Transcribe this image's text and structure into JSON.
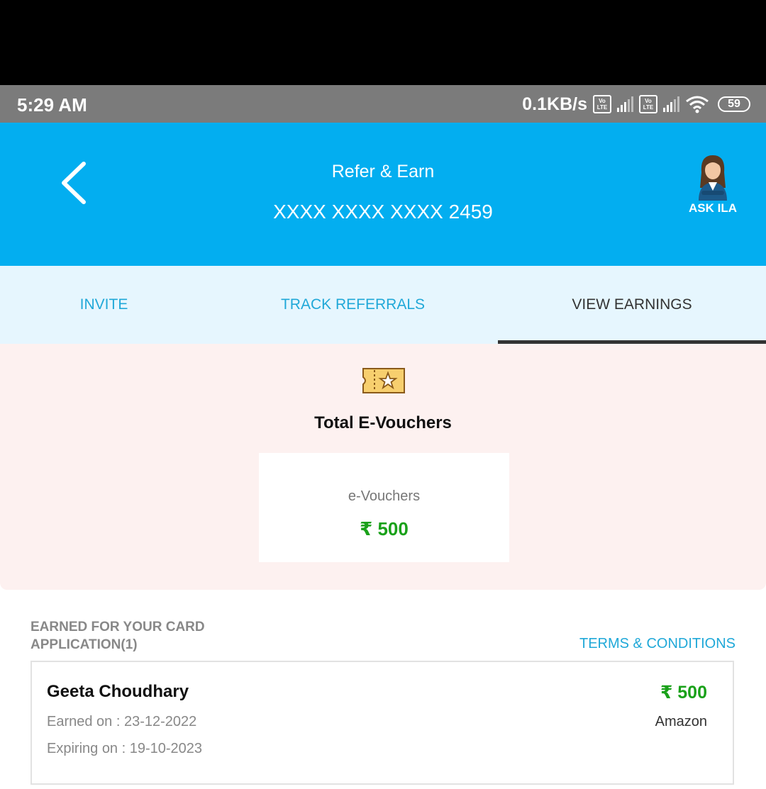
{
  "status_bar": {
    "time": "5:29 AM",
    "network_speed": "0.1KB/s",
    "volte_label": [
      "Vo",
      "LTE"
    ],
    "battery": "59"
  },
  "header": {
    "title": "Refer & Earn",
    "card_number": "XXXX XXXX XXXX 2459",
    "assistant_label": "ASK ILA",
    "back_icon": "chevron-left-icon",
    "background_color": "#03aef0"
  },
  "tabs": [
    {
      "label": "INVITE",
      "active": false
    },
    {
      "label": "TRACK REFERRALS",
      "active": false
    },
    {
      "label": "VIEW EARNINGS",
      "active": true
    }
  ],
  "summary": {
    "icon": "voucher-ticket-star-icon",
    "title": "Total E-Vouchers",
    "box_label": "e-Vouchers",
    "box_amount": "₹ 500"
  },
  "earnings": {
    "heading_line1": "EARNED FOR YOUR CARD",
    "heading_line2": "APPLICATION(1)",
    "terms_label": "TERMS & CONDITIONS",
    "items": [
      {
        "name": "Geeta Choudhary",
        "earned_on": "Earned on : 23-12-2022",
        "expiring_on": "Expiring on : 19-10-2023",
        "amount": "₹ 500",
        "brand": "Amazon"
      }
    ]
  },
  "colors": {
    "accent": "#03aef0",
    "tab_text": "#20a8d8",
    "amount_green": "#1aa11a",
    "summary_bg": "#fdf1f0"
  }
}
